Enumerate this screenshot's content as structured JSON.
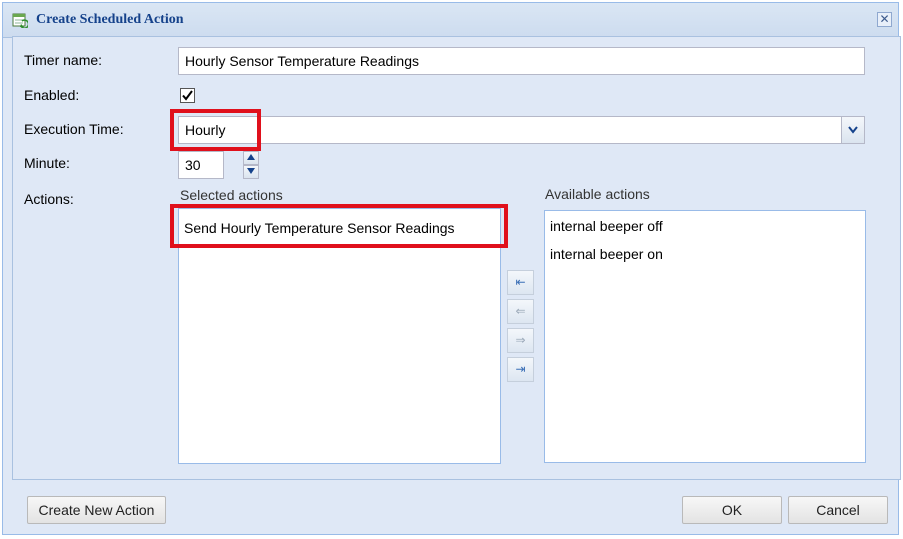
{
  "dialog": {
    "title": "Create Scheduled Action",
    "close_glyph": "✕"
  },
  "form": {
    "timer_name_label": "Timer name:",
    "timer_name_value": "Hourly Sensor Temperature Readings",
    "enabled_label": "Enabled:",
    "enabled_checked": true,
    "execution_time_label": "Execution Time:",
    "execution_time_value": "Hourly",
    "minute_label": "Minute:",
    "minute_value": "30",
    "actions_label": "Actions:"
  },
  "selected_actions": {
    "header": "Selected actions",
    "items": [
      "Send Hourly Temperature Sensor Readings"
    ]
  },
  "available_actions": {
    "header": "Available actions",
    "items": [
      "internal beeper off",
      "internal beeper on"
    ]
  },
  "transfer_buttons": [
    {
      "name": "move-all-left",
      "glyph": "⇤"
    },
    {
      "name": "move-left",
      "glyph": "⇐"
    },
    {
      "name": "move-right",
      "glyph": "⇒"
    },
    {
      "name": "move-all-right",
      "glyph": "⇥"
    }
  ],
  "footer": {
    "create_new_action": "Create New Action",
    "ok": "OK",
    "cancel": "Cancel"
  },
  "colors": {
    "highlight": "#e0101c",
    "title_text": "#15428b",
    "panel_bg": "#dfe8f6"
  },
  "icons": {
    "title": "calendar-refresh-icon",
    "dropdown": "chevron-down-icon",
    "spin_up": "caret-up-icon",
    "spin_down": "caret-down-icon"
  }
}
